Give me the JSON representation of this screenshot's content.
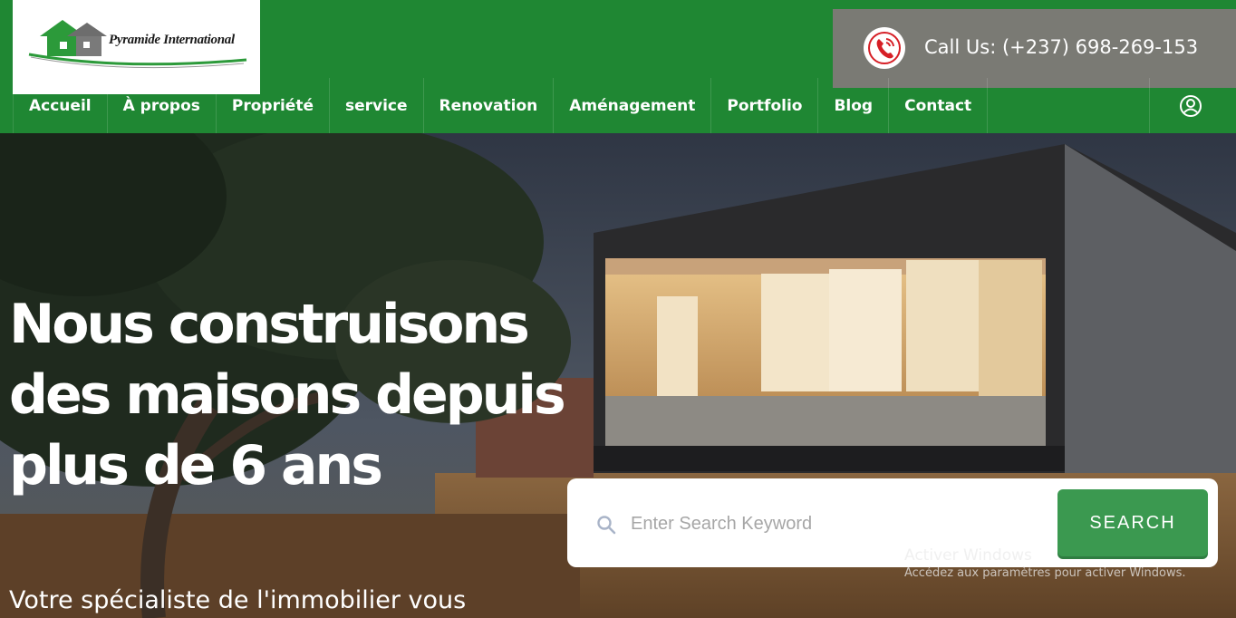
{
  "brand": {
    "logo_text": "Pyramide International"
  },
  "header": {
    "call_label": "Call Us: (+237) 698-269-153"
  },
  "nav": {
    "items": [
      {
        "label": "Accueil"
      },
      {
        "label": "À propos"
      },
      {
        "label": "Propriété"
      },
      {
        "label": "service"
      },
      {
        "label": "Renovation"
      },
      {
        "label": "Aménagement"
      },
      {
        "label": "Portfolio"
      },
      {
        "label": "Blog"
      },
      {
        "label": "Contact"
      }
    ],
    "user_icon": "user-circle-icon"
  },
  "hero": {
    "headline": "Nous construisons des maisons depuis plus de 6 ans",
    "subline": "Votre spécialiste de l'immobilier vous"
  },
  "search": {
    "placeholder": "Enter Search Keyword",
    "button_label": "SEARCH",
    "icon": "search-icon"
  },
  "watermark": {
    "title": "Activer Windows",
    "subtitle": "Accédez aux paramètres pour activer Windows."
  },
  "colors": {
    "brand_green": "#1f8733",
    "search_button": "#3b9950",
    "call_box": "#7a7a74",
    "phone_icon": "#d61f26"
  }
}
